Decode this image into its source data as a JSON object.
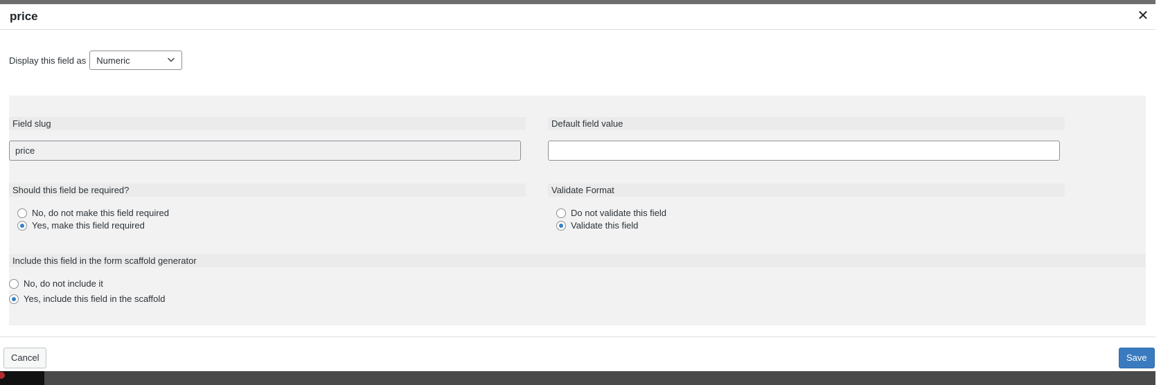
{
  "modal": {
    "title": "price",
    "close_icon": "close-icon"
  },
  "display": {
    "label": "Display this field as",
    "selected": "Numeric"
  },
  "field_slug": {
    "label": "Field slug",
    "value": "price"
  },
  "default_value": {
    "label": "Default field value",
    "value": ""
  },
  "required": {
    "label": "Should this field be required?",
    "options": [
      {
        "label": "No, do not make this field required",
        "checked": false
      },
      {
        "label": "Yes, make this field required",
        "checked": true
      }
    ]
  },
  "validate": {
    "label": "Validate Format",
    "options": [
      {
        "label": "Do not validate this field",
        "checked": false
      },
      {
        "label": "Validate this field",
        "checked": true
      }
    ]
  },
  "scaffold": {
    "label": "Include this field in the form scaffold generator",
    "options": [
      {
        "label": "No, do not include it",
        "checked": false
      },
      {
        "label": "Yes, include this field in the scaffold",
        "checked": true
      }
    ]
  },
  "footer": {
    "cancel_label": "Cancel",
    "save_label": "Save"
  },
  "colors": {
    "accent": "#3582c4",
    "save_button": "#3a7bbf"
  }
}
